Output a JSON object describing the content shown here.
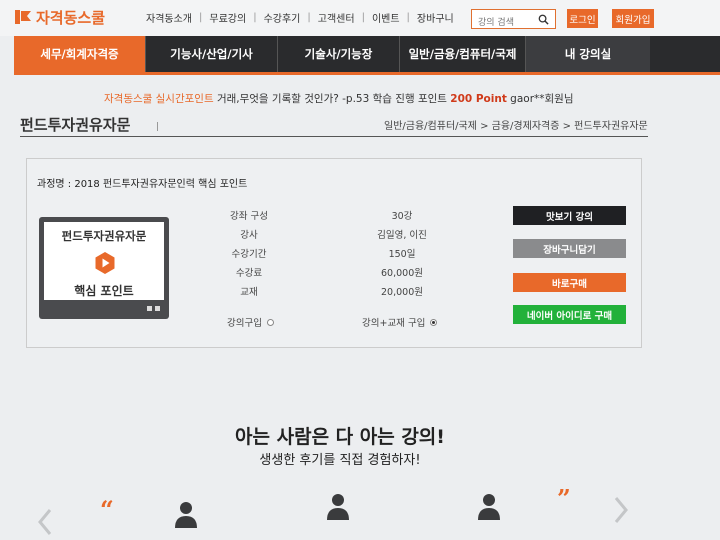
{
  "header": {
    "logo_text": "자격동스쿨",
    "nav": [
      "자격동소개",
      "무료강의",
      "수강후기",
      "고객센터",
      "이벤트",
      "장바구니"
    ],
    "search_placeholder": "강의 검색",
    "login_label": "로그인",
    "join_label": "회원가입"
  },
  "main_nav": [
    {
      "label": "세무/회계자격증",
      "active": true
    },
    {
      "label": "기능사/산업/기사",
      "active": false
    },
    {
      "label": "기술사/기능장",
      "active": false
    },
    {
      "label": "일반/금융/컴퓨터/국제",
      "active": false
    },
    {
      "label": "내 강의실",
      "active": false
    }
  ],
  "ticker": {
    "brand": "자격동스쿨",
    "label": " 실시간포인트 ",
    "message": "거래,무엇을 기록할 것인가? -p.53 학습 진행 포인트 ",
    "points": "200 Point",
    "user": " gaor**회원님"
  },
  "page": {
    "title": "펀드투자권유자문",
    "breadcrumb": "일반/금융/컴퓨터/국제 > 금융/경제자격증 > 펀드투자권유자문"
  },
  "course": {
    "name": "과정명 : 2018 펀드투자권유자문인력 핵심 포인트",
    "thumb_title": "펀드투자권유자문",
    "thumb_subtitle": "핵심 포인트",
    "info": [
      {
        "label": "강좌 구성",
        "value": "30강"
      },
      {
        "label": "강사",
        "value": "김일영, 이진"
      },
      {
        "label": "수강기간",
        "value": "150일"
      },
      {
        "label": "수강료",
        "value": "60,000원"
      },
      {
        "label": "교재",
        "value": "20,000원"
      }
    ],
    "options": [
      {
        "label": "강의구입",
        "checked": false
      },
      {
        "label": "강의+교재 구입",
        "checked": true
      }
    ],
    "buttons": {
      "preview": "맛보기 강의",
      "cart": "장바구니담기",
      "buy": "바로구매",
      "naver": "네이버 아이디로 구매"
    }
  },
  "reviews": {
    "heading": "아는 사람은 다 아는 강의!",
    "subheading": "생생한 후기를 직접 경험하자!",
    "quote_open": "“",
    "quote_close": "”"
  },
  "colors": {
    "accent": "#e8692a",
    "nav_bg": "#2a2b2d",
    "naver_green": "#22b13a"
  }
}
